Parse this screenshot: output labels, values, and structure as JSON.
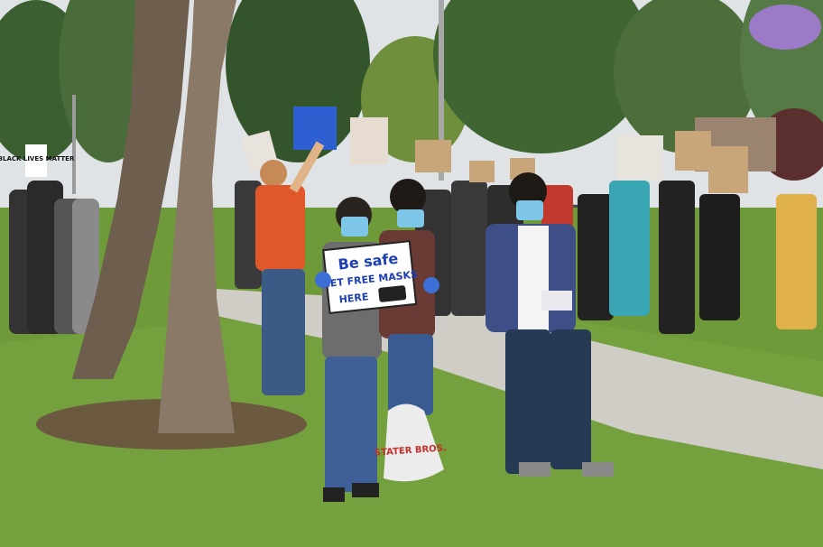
{
  "scene": {
    "description_label": "Protest photo",
    "signs": {
      "main_sign_line1": "Be safe",
      "main_sign_line2": "GET FREE MASKS",
      "main_sign_line3": "HERE",
      "left_sign": "BLACK LIVES MATTER",
      "bag_text": "STATER BROS."
    }
  },
  "colors": {
    "sky": "#dfe3e6",
    "grass": "#6f9a3a",
    "grass_dark": "#557d2a",
    "sidewalk": "#cfcdc6",
    "road": "#4a4c50",
    "tree_trunk": "#7b6a58",
    "foliage": "#3f6b33",
    "cardboard": "#c9a67a"
  }
}
